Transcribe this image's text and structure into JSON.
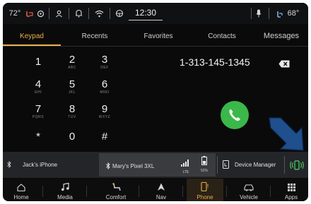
{
  "status": {
    "temp_outside": "72°",
    "time": "12:30",
    "temp_inside": "68°"
  },
  "tabs": [
    {
      "label": "Keypad",
      "active": true
    },
    {
      "label": "Recents",
      "active": false
    },
    {
      "label": "Favorites",
      "active": false
    },
    {
      "label": "Contacts",
      "active": false
    },
    {
      "label": "Messages",
      "active": false
    }
  ],
  "keypad": [
    {
      "digit": "1",
      "letters": ""
    },
    {
      "digit": "2",
      "letters": "ABC"
    },
    {
      "digit": "3",
      "letters": "DEF"
    },
    {
      "digit": "4",
      "letters": "GHI"
    },
    {
      "digit": "5",
      "letters": "JKL"
    },
    {
      "digit": "6",
      "letters": "MNO"
    },
    {
      "digit": "7",
      "letters": "PQRS"
    },
    {
      "digit": "8",
      "letters": "TUV"
    },
    {
      "digit": "9",
      "letters": "WXYZ"
    },
    {
      "digit": "*",
      "letters": ""
    },
    {
      "digit": "0",
      "letters": ""
    },
    {
      "digit": "#",
      "letters": ""
    }
  ],
  "dialer": {
    "number": "1-313-145-1345"
  },
  "devices": {
    "jack": "Jack's iPhone",
    "mary": "Mary's Pixel 3XL",
    "signal_label": "LTE",
    "battery_label": "52%",
    "manager": "Device Manager"
  },
  "nav": [
    {
      "label": "Home",
      "icon": "home-icon"
    },
    {
      "label": "Media",
      "icon": "music-note-icon"
    },
    {
      "label": "Comfort",
      "icon": "seat-icon"
    },
    {
      "label": "Nav",
      "icon": "navigation-arrow-icon"
    },
    {
      "label": "Phone",
      "icon": "phone-icon",
      "active": true
    },
    {
      "label": "Vehicle",
      "icon": "car-icon"
    },
    {
      "label": "Apps",
      "icon": "grid-icon"
    }
  ],
  "colors": {
    "accent": "#e8b04a",
    "call": "#3bb84a",
    "arrow": "#1f4f8c"
  }
}
